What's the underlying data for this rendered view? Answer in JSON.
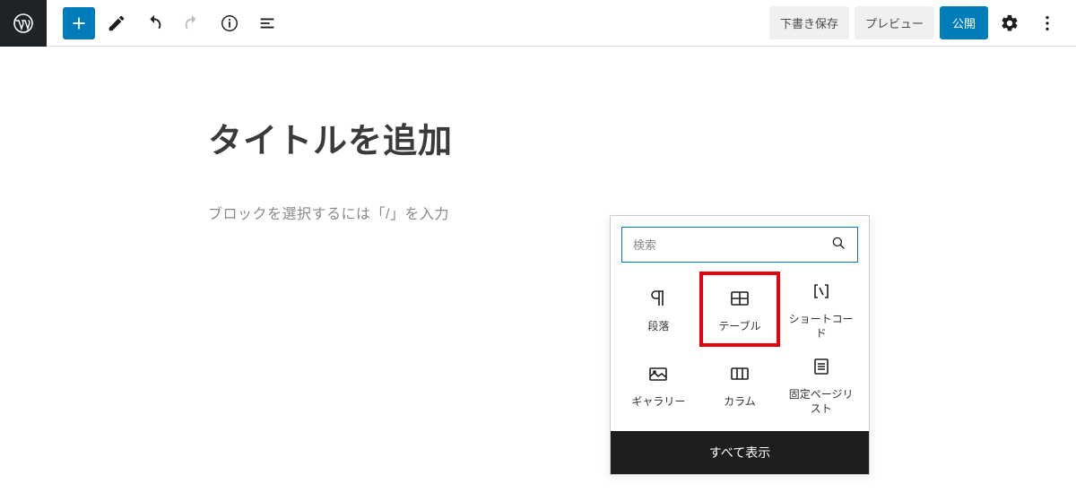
{
  "toolbar": {
    "save_draft": "下書き保存",
    "preview": "プレビュー",
    "publish": "公開"
  },
  "editor": {
    "title_placeholder": "タイトルを追加",
    "body_placeholder": "ブロックを選択するには「/」を入力"
  },
  "inserter": {
    "search_placeholder": "検索",
    "show_all": "すべて表示",
    "blocks": [
      {
        "id": "paragraph",
        "label": "段落"
      },
      {
        "id": "table",
        "label": "テーブル"
      },
      {
        "id": "shortcode",
        "label": "ショートコード"
      },
      {
        "id": "gallery",
        "label": "ギャラリー"
      },
      {
        "id": "columns",
        "label": "カラム"
      },
      {
        "id": "page-list",
        "label": "固定ページリスト"
      }
    ]
  }
}
